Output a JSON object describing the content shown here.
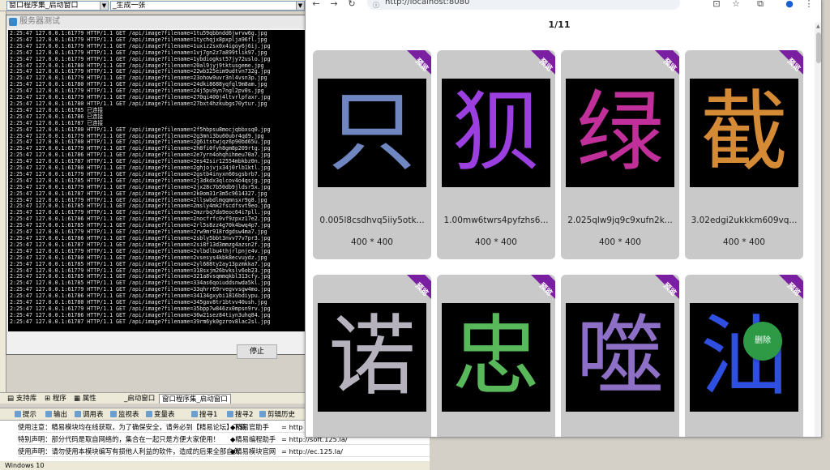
{
  "ide": {
    "combo_left": "窗口程序集_启动窗口",
    "combo_right": "_生成一张",
    "console_title": "服务器测试",
    "stop_label": "停止",
    "log_prefix": "2:25:47 127.0.0.1:",
    "log_lines": [
      "61779 HTTP/1.1 GET /api/image?filename=1tu59qbbndd6jwrvw6g.jpg",
      "61779 HTTP/1.1 GET /api/image?filename=1tychqjx8pxplja96fl.jpg",
      "61779 HTTP/1.1 GET /api/image?filename=1uxiz2sx0x4igoy6j6ij.jpg",
      "61779 HTTP/1.1 GET /api/image?filename=1vj7gn2z7a899tlik97.jpg",
      "61779 HTTP/1.1 GET /api/image?filename=1ybdiogkst57jy72uslo.jpg",
      "61780 HTTP/1.1 GET /api/image?filename=20al9jyj9tktusgeme.jpg",
      "61779 HTTP/1.1 GET /api/image?filename=22wb325eim9udtvn732g.jpg",
      "61779 HTTP/1.1 GET /api/image?filename=23ohow9uvr3nl4vsn3p.jpg",
      "61780 HTTP/1.1 GET /api/image?filename=24dki8688yqfql9m8am.jpg",
      "61779 HTTP/1.1 GET /api/image?filename=24j5pu9yn7ngl2pv0s.jpg",
      "61779 HTTP/1.1 GET /api/image?filename=270qi400j4ltvrlpfaxr.jpg",
      "61780 HTTP/1.1 GET /api/image?filename=27bxt4hzkubgs70ytur.jpg",
      "61785 已连接",
      "61786 已连接",
      "61787 已连接",
      "61780 HTTP/1.1 GET /api/image?filename=2f5hbpsu8mocjqbbxsq0.jpg",
      "61779 HTTP/1.1 GET /api/image?filename=2g3mni3bu60ubr4qd9.jpg",
      "61780 HTTP/1.1 GET /api/image?filename=2g6itstwjqz6p90bd65u.jpg",
      "61779 HTTP/1.1 GET /api/image?filename=2h8fi0fyh8gm8p209rtg.jpg",
      "61786 HTTP/1.1 GET /api/image?filename=2e7yrn4ohqhihmeu70a7.jpg",
      "61787 HTTP/1.1 GET /api/image?filename=2es42sir12554mbkbz0n.jpg",
      "61780 HTTP/1.1 GET /api/image?filename=2ghjojvjx34j0rlb1ktl.jpg",
      "61779 HTTP/1.1 GET /api/image?filename=2gstb4inyxn60sgsbrb7.jpg",
      "61785 HTTP/1.1 GET /api/image?filename=2j3dkdx3qlcov4o4qsjg.jpg",
      "61779 HTTP/1.1 GET /api/image?filename=2jx28c7b50db9jldsr5x.jpg",
      "61787 HTTP/1.1 GET /api/image?filename=2k0om31r3m5c9614327.jpg",
      "61779 HTTP/1.1 GET /api/image?filename=2llswbdlmqqmnsxr9g8.jpg",
      "61785 HTTP/1.1 GET /api/image?filename=2msly4mk2fscdfsvt9eo.jpg",
      "61779 HTTP/1.1 GET /api/image?filename=2mzrbq7da9eoc64i7pll.jpg",
      "61786 HTTP/1.1 GET /api/image?filename=2nocfrfc0vf9zpxz17e2.jpg",
      "61785 HTTP/1.1 GET /api/image?filename=2rl5s8zz4g70k4bwq4p7.jpg",
      "61779 HTTP/1.1 GET /api/image?filename=2rw9mr918rdgdsw4ma7.jpg",
      "61786 HTTP/1.1 GET /api/image?filename=2sbly5bbt3nvv77v7pr3.jpg",
      "61787 HTTP/1.1 GET /api/image?filename=2si8f13d3mmzg4azsn2f.jpg",
      "61779 HTTP/1.1 GET /api/image?filename=2vlbdlbu4thjrlpnje4v.jpg",
      "61780 HTTP/1.1 GET /api/image?filename=2vsesys4kbk8ecvuydz.jpg",
      "61785 HTTP/1.1 GET /api/image?filename=2yl688ty2ay13pzmkka7.jpg",
      "61779 HTTP/1.1 GET /api/image?filename=318sxjm26bvkslv6ob23.jpg",
      "61785 HTTP/1.1 GET /api/image?filename=321a8vsqmmqkbl313cfy.jpg",
      "61785 HTTP/1.1 GET /api/image?filename=334as6qoiuddsnwda5kl.jpg",
      "61779 HTTP/1.1 GET /api/image?filename=33qhrr69rvegvvsgw4mo.jpg",
      "61786 HTTP/1.1 GET /api/image?filename=34134gxybi1816bdiypu.jpg",
      "61780 HTTP/1.1 GET /api/image?filename=345gav8tr1btvv40ush.jpg",
      "61779 HTTP/1.1 GET /api/image?filename=35bpp7w846zx0mpsn9rv.jpg",
      "61786 HTTP/1.1 GET /api/image?filename=36w21sez84tiyn3uhq84.jpg",
      "61787 HTTP/1.1 GET /api/image?filename=39rm6yk0gzrov8lac2sl.jpg"
    ],
    "bottom_tabs": [
      "支持库",
      "程序",
      "属性",
      "_启动窗口",
      "窗口程序集_启动窗口"
    ],
    "toolbar_items": [
      "提示",
      "输出",
      "调用表",
      "监视表",
      "变量表",
      "搜寻1",
      "搜寻2",
      "剪辑历史"
    ],
    "notices": [
      {
        "text": "使用注意：精易模块均在线获取，为了确保安全，请务必到【精易论坛】下载",
        "label": "◆精易官助手",
        "value": "= http"
      },
      {
        "text": "特别声明：部分代码是取自网络的，集合在一起只是方便大家使用！",
        "label": "◆精易编程助手",
        "value": "= http://soft.125.la/"
      },
      {
        "text": "使用声明：请勿使用本模块编写有损他人利益的软件，造成的后果全部自负",
        "label": "◆精易模块官网",
        "value": "= http://ec.125.la/"
      }
    ],
    "status_text": "Windows 10"
  },
  "browser": {
    "url": "http://localhost:8080",
    "pager": "1/11",
    "ribbon_label": "预览",
    "delete_label": "删除",
    "cards": [
      {
        "char": "只",
        "color": "#6f86c0",
        "name": "0.005l8csdhvq5iiy5otk...",
        "size": "400 * 400"
      },
      {
        "char": "狈",
        "color": "#9b3fe0",
        "name": "1.00mw6twrs4pyfzhs6...",
        "size": "400 * 400"
      },
      {
        "char": "绿",
        "color": "#c02f9a",
        "name": "2.025qlw9jq9c9xufn2k...",
        "size": "400 * 400"
      },
      {
        "char": "截",
        "color": "#d58a36",
        "name": "3.02edgi2ukkkm609vq...",
        "size": "400 * 400"
      },
      {
        "char": "诺",
        "color": "#b5b2be",
        "name": "",
        "size": ""
      },
      {
        "char": "忠",
        "color": "#58b85a",
        "name": "",
        "size": ""
      },
      {
        "char": "噬",
        "color": "#8d6fc6",
        "name": "",
        "size": ""
      },
      {
        "char": "汕",
        "color": "#2f4fe0",
        "name": "",
        "size": ""
      }
    ],
    "accent": "#7a1fa2"
  }
}
